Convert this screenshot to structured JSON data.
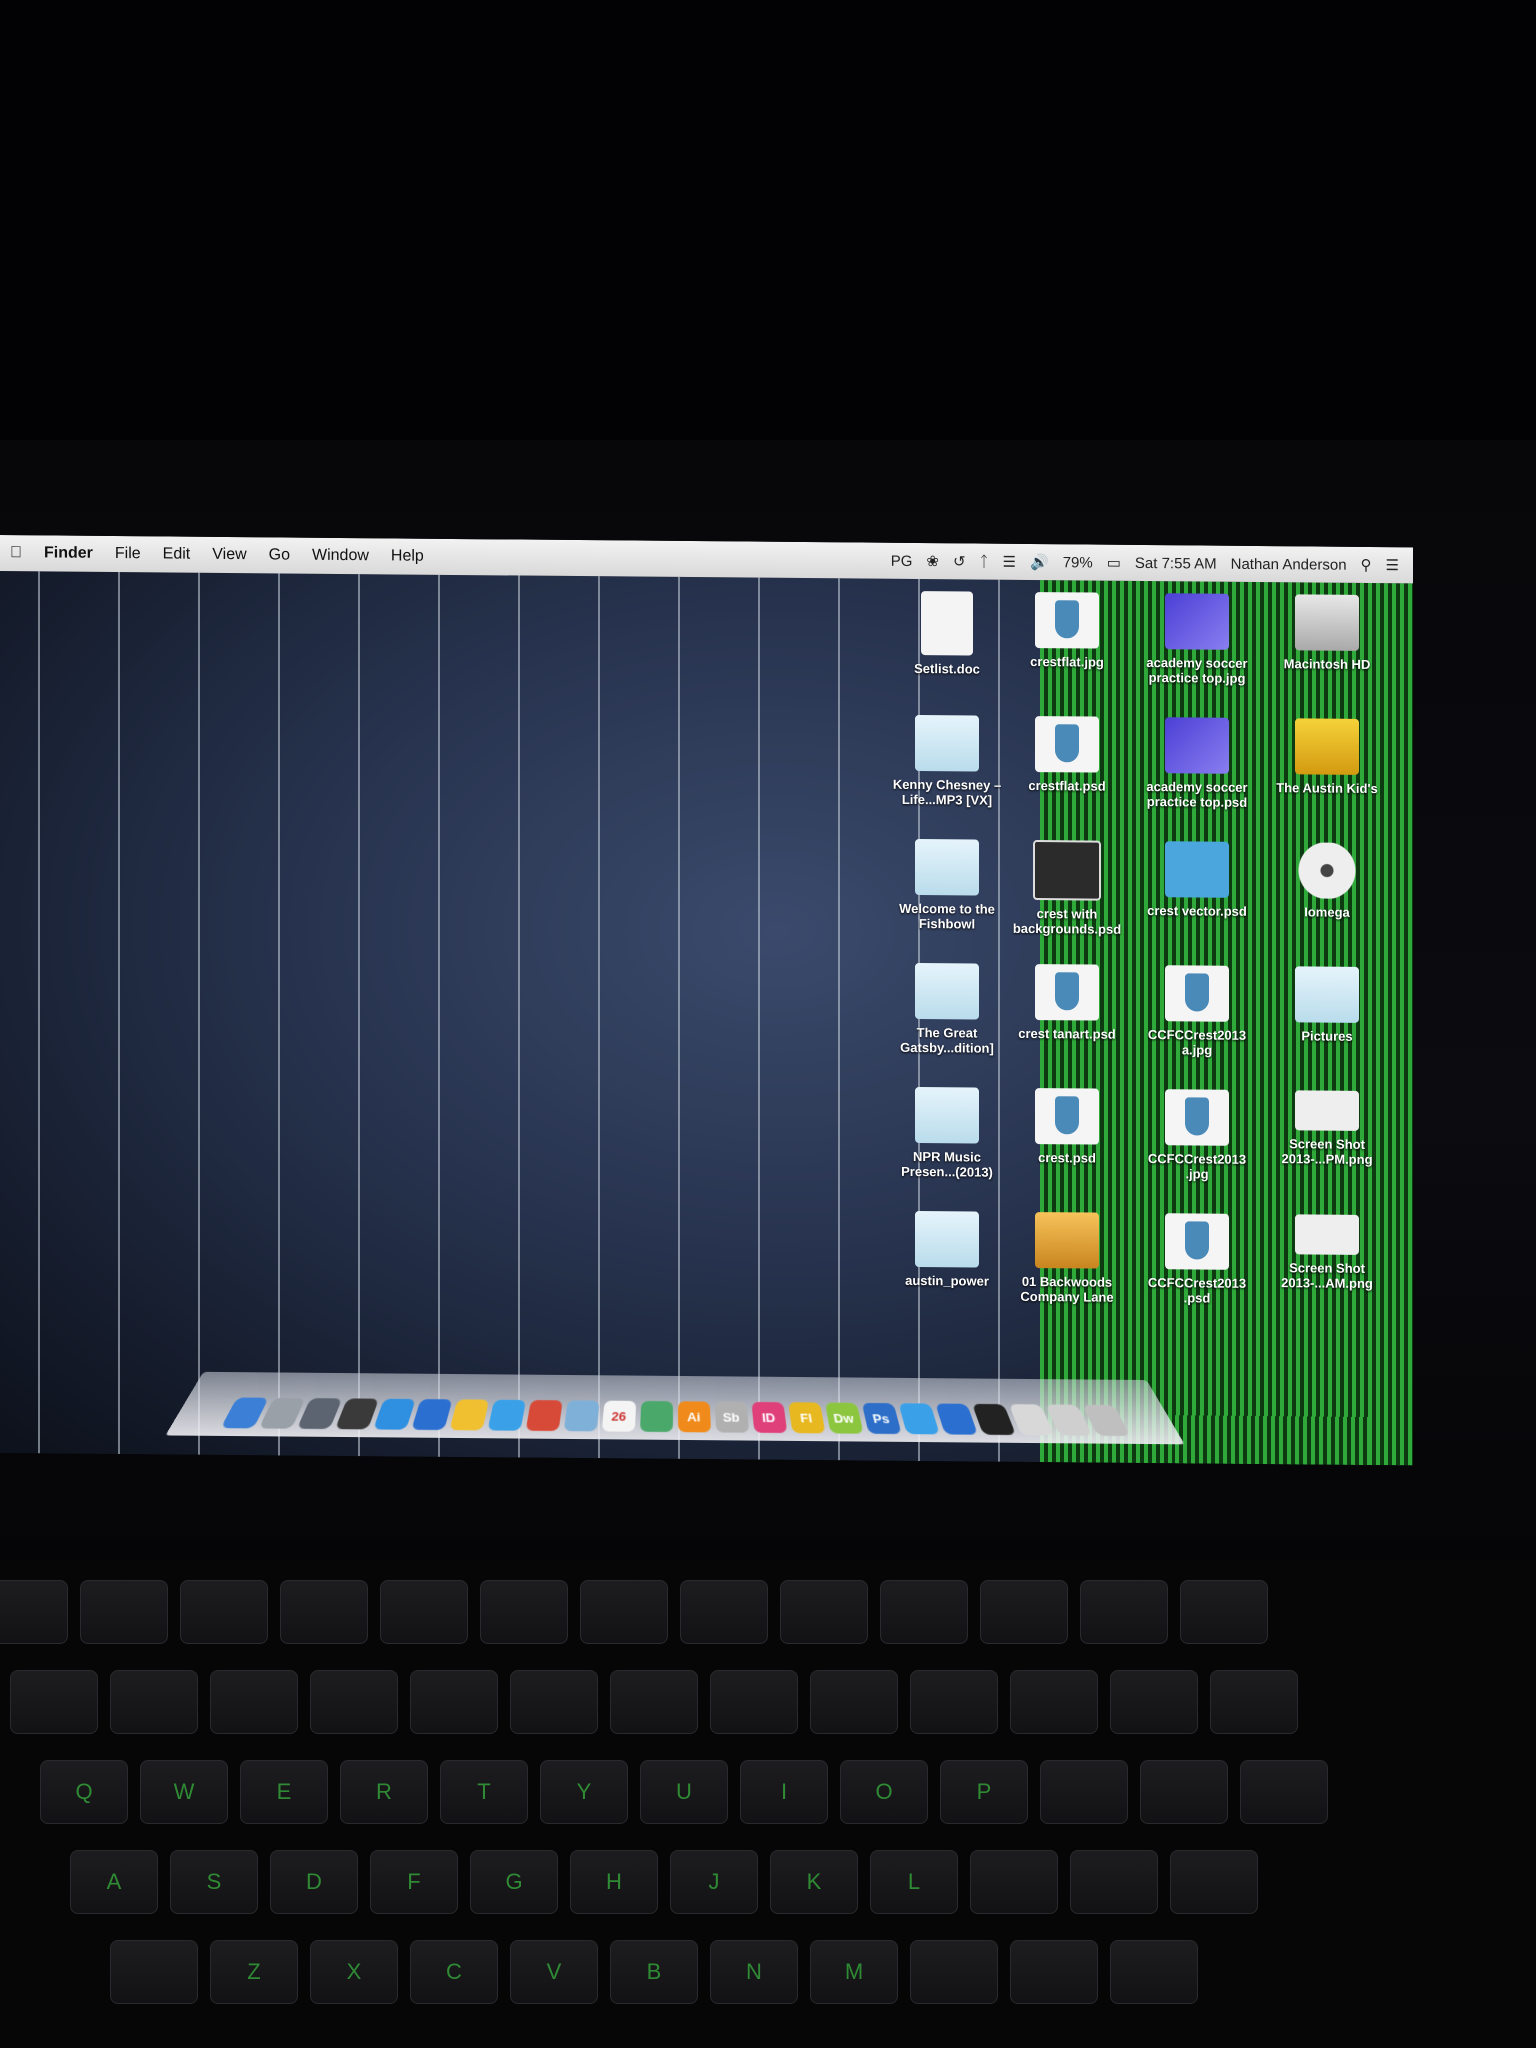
{
  "menubar": {
    "app": "Finder",
    "items": [
      "File",
      "Edit",
      "View",
      "Go",
      "Window",
      "Help"
    ],
    "status": {
      "parental": "PG",
      "battery": "79%",
      "clock": "Sat 7:55 AM",
      "user": "Nathan Anderson"
    }
  },
  "desktop_icons": [
    {
      "label": "Setlist.doc",
      "kind": "doc"
    },
    {
      "label": "Kenny Chesney – Life...MP3 [VX]",
      "kind": "folder"
    },
    {
      "label": "Welcome to the Fishbowl",
      "kind": "folder"
    },
    {
      "label": "The Great Gatsby...dition]",
      "kind": "folder"
    },
    {
      "label": "NPR Music Presen...(2013)",
      "kind": "folder"
    },
    {
      "label": "austin_power",
      "kind": "folder"
    },
    {
      "label": "crestflat.jpg",
      "kind": "crest"
    },
    {
      "label": "crestflat.psd",
      "kind": "crest"
    },
    {
      "label": "crest with backgrounds.psd",
      "kind": "dark"
    },
    {
      "label": "crest tanart.psd",
      "kind": "crest"
    },
    {
      "label": "crest.psd",
      "kind": "crest"
    },
    {
      "label": "01 Backwoods Company Lane",
      "kind": "orange"
    },
    {
      "label": "academy soccer practice top.jpg",
      "kind": "purple"
    },
    {
      "label": "academy soccer practice top.psd",
      "kind": "purple"
    },
    {
      "label": "crest vector.psd",
      "kind": "blue"
    },
    {
      "label": "CCFCCrest2013 a.jpg",
      "kind": "crest"
    },
    {
      "label": "CCFCCrest2013 .jpg",
      "kind": "crest"
    },
    {
      "label": "CCFCCrest2013 .psd",
      "kind": "crest"
    },
    {
      "label": "Macintosh HD",
      "kind": "drive"
    },
    {
      "label": "The Austin Kid's",
      "kind": "usb"
    },
    {
      "label": "Iomega",
      "kind": "disc"
    },
    {
      "label": "Pictures",
      "kind": "folder"
    },
    {
      "label": "Screen Shot 2013-...PM.png",
      "kind": "shot"
    },
    {
      "label": "Screen Shot 2013-...AM.png",
      "kind": "shot"
    }
  ],
  "dock": {
    "items": [
      {
        "name": "finder",
        "text": "",
        "color": "#3b7fd6"
      },
      {
        "name": "launchpad",
        "text": "",
        "color": "#9aa0a8"
      },
      {
        "name": "mission-control",
        "text": "",
        "color": "#5b6470"
      },
      {
        "name": "dashboard",
        "text": "",
        "color": "#3a3a3a"
      },
      {
        "name": "app-store",
        "text": "",
        "color": "#2f8fe0"
      },
      {
        "name": "itunes",
        "text": "",
        "color": "#2b6fd0"
      },
      {
        "name": "mail",
        "text": "",
        "color": "#f0c030"
      },
      {
        "name": "safari",
        "text": "",
        "color": "#3aa0e8"
      },
      {
        "name": "chrome",
        "text": "",
        "color": "#d84a38"
      },
      {
        "name": "preview",
        "text": "",
        "color": "#7fb0d8"
      },
      {
        "name": "calendar",
        "text": "26",
        "color": "#f4f4f4"
      },
      {
        "name": "iphoto",
        "text": "",
        "color": "#4aa86a"
      },
      {
        "name": "illustrator",
        "text": "Ai",
        "color": "#f08a1a"
      },
      {
        "name": "storyboard",
        "text": "Sb",
        "color": "#b0b0b0"
      },
      {
        "name": "indesign",
        "text": "ID",
        "color": "#e0407a"
      },
      {
        "name": "flash",
        "text": "Fl",
        "color": "#e8b820"
      },
      {
        "name": "dreamweaver",
        "text": "Dw",
        "color": "#8cc63f"
      },
      {
        "name": "photoshop",
        "text": "Ps",
        "color": "#2d6ec8"
      },
      {
        "name": "stickies",
        "text": "",
        "color": "#3aa0e8"
      },
      {
        "name": "network",
        "text": "",
        "color": "#2b6fd0"
      },
      {
        "name": "activity-monitor",
        "text": "",
        "color": "#222"
      },
      {
        "name": "documents",
        "text": "",
        "color": "#d8d8d8"
      },
      {
        "name": "downloads",
        "text": "",
        "color": "#cfcfcf"
      },
      {
        "name": "trash",
        "text": "",
        "color": "#bfbfbf"
      }
    ]
  },
  "keyboard": {
    "rows": [
      [
        "",
        "",
        "",
        "",
        "",
        "",
        "",
        "",
        "",
        "",
        "",
        "",
        ""
      ],
      [
        "",
        "",
        "",
        "",
        "",
        "",
        "",
        "",
        "",
        "",
        "",
        "",
        ""
      ],
      [
        "Q",
        "W",
        "E",
        "R",
        "T",
        "Y",
        "U",
        "I",
        "O",
        "P",
        "",
        "",
        ""
      ],
      [
        "A",
        "S",
        "D",
        "F",
        "G",
        "H",
        "J",
        "K",
        "L",
        "",
        "",
        ""
      ],
      [
        "",
        "Z",
        "X",
        "C",
        "V",
        "B",
        "N",
        "M",
        "",
        "",
        ""
      ]
    ]
  }
}
